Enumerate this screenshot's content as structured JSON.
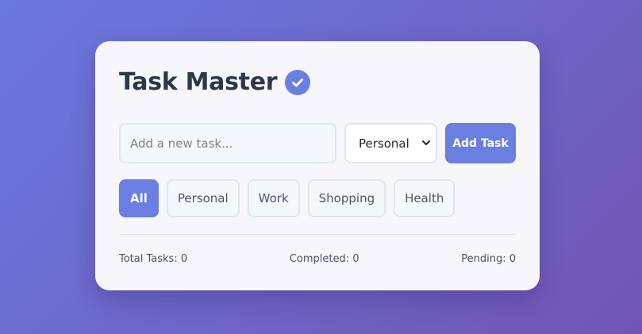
{
  "app": {
    "title": "Task Master"
  },
  "colors": {
    "accent": "#6b7fe3",
    "card": "#f6f6fb",
    "text": "#2d3748"
  },
  "form": {
    "input_placeholder": "Add a new task...",
    "input_value": "",
    "category_selected": "Personal",
    "add_label": "Add Task"
  },
  "filters": [
    {
      "label": "All",
      "active": true
    },
    {
      "label": "Personal",
      "active": false
    },
    {
      "label": "Work",
      "active": false
    },
    {
      "label": "Shopping",
      "active": false
    },
    {
      "label": "Health",
      "active": false
    }
  ],
  "stats": {
    "total": "Total Tasks: 0",
    "completed": "Completed: 0",
    "pending": "Pending: 0"
  }
}
